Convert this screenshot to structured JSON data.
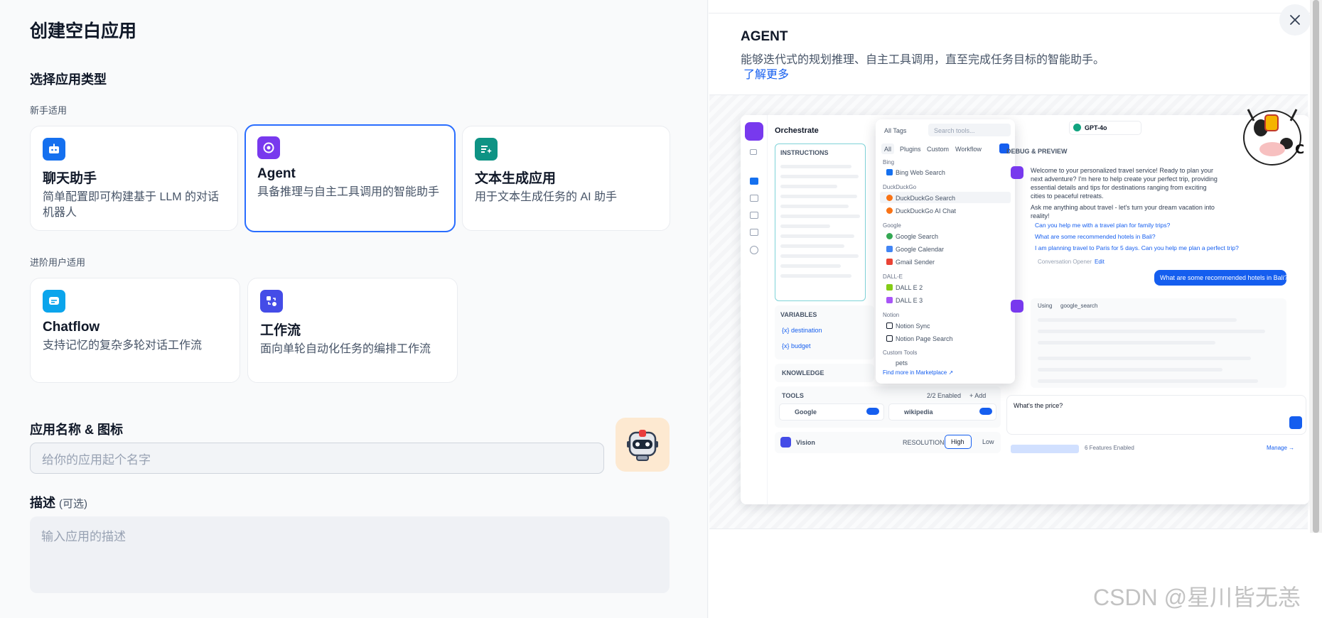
{
  "dialog": {
    "title": "创建空白应用",
    "close_icon": "close-icon"
  },
  "app_type": {
    "section_title": "选择应用类型",
    "beginner_label": "新手适用",
    "advanced_label": "进阶用户适用",
    "cards": [
      {
        "name": "聊天助手",
        "desc": "简单配置即可构建基于 LLM 的对话机器人",
        "icon": "chat-bot-icon",
        "color": "#1570ef"
      },
      {
        "name": "Agent",
        "desc": "具备推理与自主工具调用的智能助手",
        "icon": "agent-icon",
        "color": "#7839ee",
        "selected": true
      },
      {
        "name": "文本生成应用",
        "desc": "用于文本生成任务的 AI 助手",
        "icon": "text-generator-icon",
        "color": "#0e9384"
      },
      {
        "name": "Chatflow",
        "desc": "支持记忆的复杂多轮对话工作流",
        "icon": "chatflow-icon",
        "color": "#0ba5ec"
      },
      {
        "name": "工作流",
        "desc": "面向单轮自动化任务的编排工作流",
        "icon": "workflow-icon",
        "color": "#444ce7"
      }
    ]
  },
  "app_name": {
    "label": "应用名称 & 图标",
    "placeholder": "给你的应用起个名字",
    "emoji_icon": "robot-icon"
  },
  "description": {
    "label": "描述",
    "optional": "(可选)",
    "placeholder": "输入应用的描述"
  },
  "preview": {
    "title": "AGENT",
    "desc": "能够迭代式的规划推理、自主工具调用，直至完成任务目标的智能助手。",
    "learn_more": "了解更多",
    "screenshot": {
      "orchestrate": "Orchestrate",
      "model": "GPT-4o",
      "instructions": "INSTRUCTIONS",
      "variables": "VARIABLES",
      "var_destination": "{x} destination",
      "var_budget": "{x} budget",
      "knowledge": "KNOWLEDGE",
      "tools": "TOOLS",
      "tools_enabled": "2/2 Enabled",
      "add": "+ Add",
      "tool_google": "Google",
      "tool_wikipedia": "wikipedia",
      "vision": "Vision",
      "resolution": "RESOLUTION",
      "high": "High",
      "low": "Low",
      "all_tags": "All Tags",
      "search_tools": "Search tools...",
      "tool_tabs": [
        "All",
        "Plugins",
        "Custom",
        "Workflow"
      ],
      "tool_list": [
        {
          "group": "Bing",
          "items": [
            "Bing Web Search"
          ]
        },
        {
          "group": "DuckDuckGo",
          "items": [
            "DuckDuckGo Search",
            "DuckDuckGo AI Chat"
          ]
        },
        {
          "group": "Google",
          "items": [
            "Google Search",
            "Google Calendar",
            "Gmail Sender"
          ]
        },
        {
          "group": "DALL-E",
          "items": [
            "DALL E 2",
            "DALL E 3"
          ]
        },
        {
          "group": "Notion",
          "items": [
            "Notion Sync",
            "Notion Page Search"
          ]
        },
        {
          "group": "Custom Tools",
          "items": [
            "pets"
          ]
        }
      ],
      "find_more": "Find more in Marketplace ↗",
      "debug_preview": "DEBUG & PREVIEW",
      "welcome": "Welcome to your personalized travel service! Ready to plan your next adventure? I'm here to help create your perfect trip, providing essential details and tips for destinations ranging from exciting cities to peaceful retreats.",
      "ask": "Ask me anything about travel - let's turn your dream vacation into reality!",
      "suggestions": [
        "Can you help me with a travel plan for family trips?",
        "What are some recommended hotels in Bali?",
        "I am planning travel to Paris for 5 days. Can you help me plan a perfect trip?"
      ],
      "conversation_opener": "Conversation Opener",
      "edit": "Edit",
      "user_msg": "What are some recommended hotels in Bali?",
      "using": "Using",
      "google_search": "google_search",
      "input_text": "What's the price?",
      "features_enabled": "6 Features Enabled",
      "manage": "Manage →"
    }
  },
  "watermark": "CSDN @星川皆无恙"
}
